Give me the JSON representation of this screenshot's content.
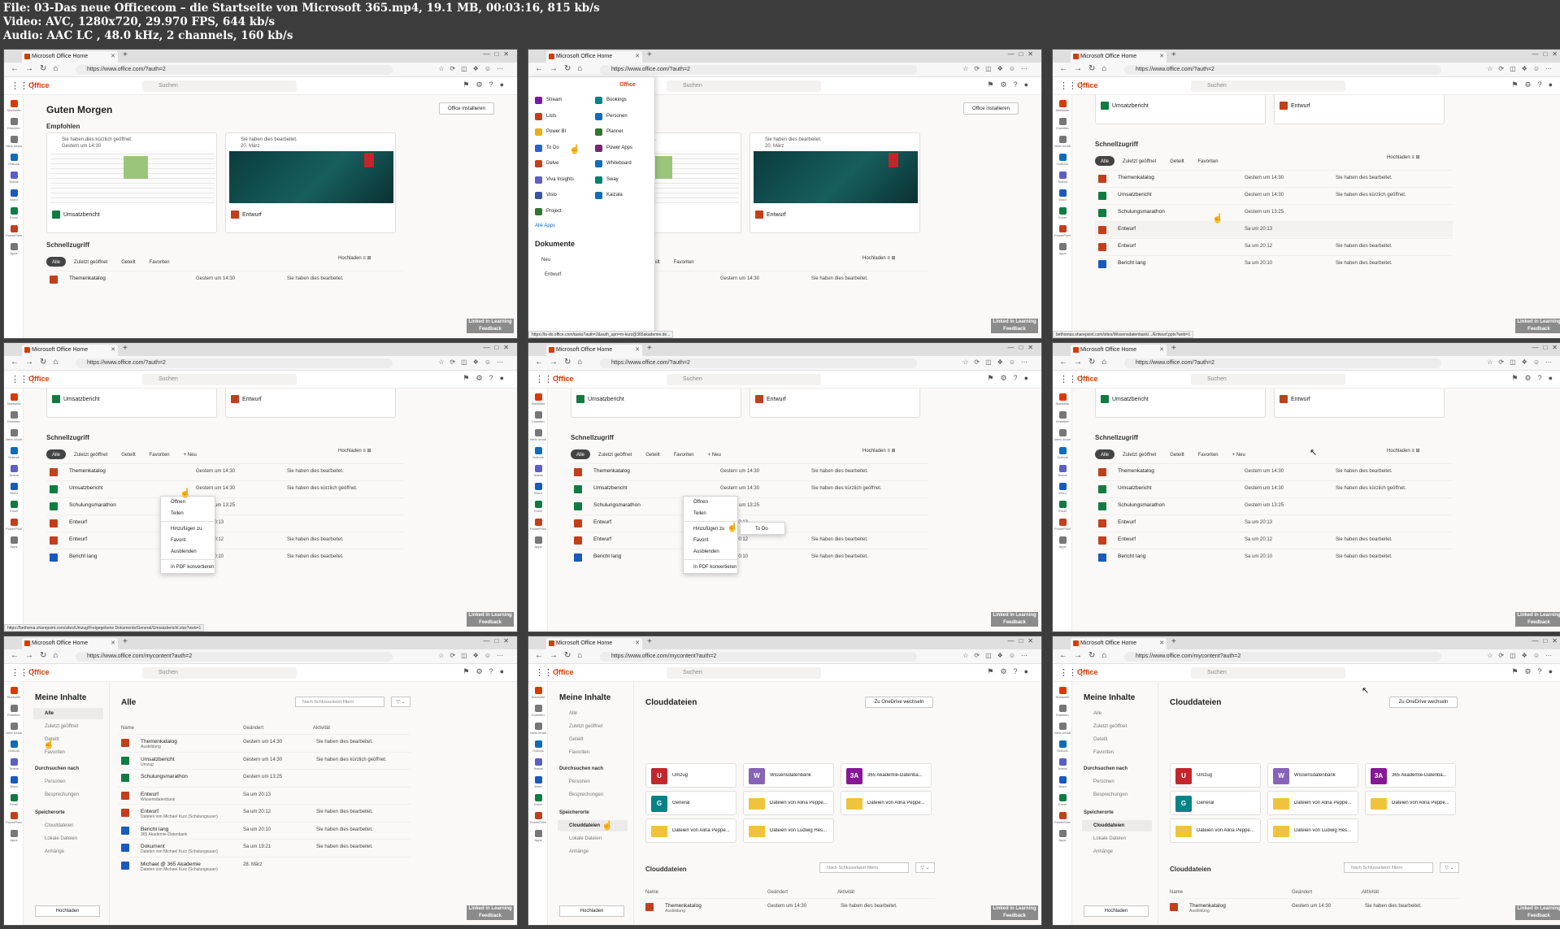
{
  "meta": [
    "File: 03-Das neue Officecom – die Startseite von Microsoft 365.mp4, 19.1 MB, 00:03:16, 815 kb/s",
    "Video: AVC, 1280x720, 29.970 FPS, 644 kb/s",
    "Audio: AAC LC , 48.0 kHz, 2 channels, 160 kb/s"
  ],
  "browser": {
    "tab_title": "Microsoft Office Home",
    "url_home": "https://www.office.com/?auth=2",
    "url_content": "https://www.office.com/mycontent?auth=2"
  },
  "office": {
    "brand": "Office",
    "search_placeholder": "Suchen",
    "greeting": "Guten Morgen",
    "install_button": "Office installieren",
    "recommended": "Empfohlen",
    "quick_access": "Schnellzugriff"
  },
  "rail": [
    "Startseite",
    "Erstellen",
    "Mein Inhalt",
    "Outlook",
    "Teams",
    "Word",
    "Excel",
    "PowerPoint",
    "Apps"
  ],
  "cards": [
    {
      "head": "Sie haben dies kürzlich geöffnet.",
      "sub": "Gestern um 14:30",
      "name": "Umsatzbericht"
    },
    {
      "head": "Sie haben dies bearbeitet.",
      "sub": "20. März",
      "name": "Entwurf"
    }
  ],
  "pills": {
    "alle": "Alle",
    "recent": "Zuletzt geöffnet",
    "shared": "Geteilt",
    "fav": "Favoriten",
    "new": "+ Neu",
    "upload": "Hochladen"
  },
  "rows": [
    {
      "name": "Themenkatalog",
      "date": "Gestern um 14:30",
      "act": "Sie haben dies bearbeitet."
    },
    {
      "name": "Umsatzbericht",
      "date": "Gestern um 14:30",
      "act": "Sie haben dies kürzlich geöffnet."
    },
    {
      "name": "Schulungsmarathon",
      "date": "Gestern um 13:25",
      "act": ""
    },
    {
      "name": "Entwurf",
      "date": "Sa um 20:13",
      "act": ""
    },
    {
      "name": "Entwurf",
      "date": "Sa um 20:12",
      "act": "Sie haben dies bearbeitet."
    },
    {
      "name": "Bericht lang",
      "date": "Sa um 20:10",
      "act": "Sie haben dies bearbeitet."
    }
  ],
  "apps": {
    "header": "Office",
    "left": [
      "Stream",
      "Lists",
      "Power BI",
      "To Do",
      "Delve",
      "Viva Insights",
      "Visio",
      "Project"
    ],
    "right": [
      "Bookings",
      "Personen",
      "Planner",
      "Power Apps",
      "Whiteboard",
      "Sway",
      "Kaizala"
    ],
    "all_apps": "Alle Apps",
    "documents": "Dokumente",
    "new": "Neu",
    "doc_item": "Entwurf",
    "status_url": "https://to-do.office.com/tasks?auth=2&auth_upn=m-kurz@365akademie.de..."
  },
  "context_menu": [
    "Öffnen",
    "Teilen",
    "Hinzufügen zu",
    "Favorit",
    "Ausblenden",
    "In PDF konvertieren"
  ],
  "submenu": "To Do",
  "status_urls": {
    "p3": "bethomas.sharepoint.com/sites/Wissensdatenbank/.../Entwurf.pptx?web=1",
    "p4": "https://bethoma.sharepoint.com/sites/Umzug/Freigegebene Dokumente/General/Umsatzbericht.xlsx?web=1"
  },
  "mycontent": {
    "title": "Meine Inhalte",
    "nav": [
      "Alle",
      "Zuletzt geöffnet",
      "Geteilt",
      "Favoriten"
    ],
    "browse_by": "Durchsuchen nach",
    "browse": [
      "Personen",
      "Besprechungen"
    ],
    "locations_head": "Speicherorte",
    "locations": [
      "Clouddateien",
      "Lokale Dateien",
      "Anhänge"
    ],
    "upload": "Hochladen",
    "all_title": "Alle",
    "filter_placeholder": "Nach Schlüsselwort filtern",
    "col_name": "Name",
    "col_changed": "Geändert",
    "col_activity": "Aktivität",
    "files": [
      {
        "name": "Themenkatalog",
        "sub": "Ausbildung",
        "date": "Gestern um 14:30",
        "act": "Sie haben dies bearbeitet."
      },
      {
        "name": "Umsatzbericht",
        "sub": "Umzug",
        "date": "Gestern um 14:30",
        "act": "Sie haben dies kürzlich geöffnet."
      },
      {
        "name": "Schulungsmarathon",
        "sub": "",
        "date": "Gestern um 13:25",
        "act": ""
      },
      {
        "name": "Entwurf",
        "sub": "Wissensdatenbank",
        "date": "Sa um 20:13",
        "act": ""
      },
      {
        "name": "Entwurf",
        "sub": "Dateien von Michael Kurz (Schulungsuser)",
        "date": "Sa um 20:12",
        "act": "Sie haben dies bearbeitet."
      },
      {
        "name": "Bericht lang",
        "sub": "365 Akademie-Datenbank",
        "date": "Sa um 20:10",
        "act": "Sie haben dies bearbeitet."
      },
      {
        "name": "Dokument",
        "sub": "Dateien von Michael Kurz (Schulungsuser)",
        "date": "Sa um 19:21",
        "act": "Sie haben dies bearbeitet."
      },
      {
        "name": "Michael @ 365 Akademie",
        "sub": "Dateien von Michael Kurz (Schulungsuser)",
        "date": "28. März",
        "act": ""
      }
    ],
    "cloud_title": "Clouddateien",
    "onedrive_button": "Zu OneDrive wechseln",
    "tiles": [
      {
        "badge": "U",
        "color": "#c4262e",
        "name": "Umzug"
      },
      {
        "badge": "W",
        "color": "#8764b8",
        "name": "Wissensdatenbank"
      },
      {
        "badge": "3A",
        "color": "#881798",
        "name": "365 Akademie-Datenba..."
      },
      {
        "badge": "G",
        "color": "#038387",
        "name": "General"
      },
      {
        "badge": "",
        "color": "#f0c33c",
        "name": "Dateien von Alina Peppe..."
      },
      {
        "badge": "",
        "color": "#f0c33c",
        "name": "Dateien von Alina Peppe..."
      },
      {
        "badge": "",
        "color": "#f0c33c",
        "name": "Dateien von Alina Peppe..."
      },
      {
        "badge": "",
        "color": "#f0c33c",
        "name": "Dateien von Ludwig Hes..."
      }
    ],
    "cloud_row": {
      "name": "Themenkatalog",
      "sub": "Ausbildung",
      "date": "Gestern um 14:30",
      "act": "Sie haben dies bearbeitet."
    }
  },
  "watermark": {
    "line1": "Linked in Learning",
    "line2": "Feedback"
  }
}
